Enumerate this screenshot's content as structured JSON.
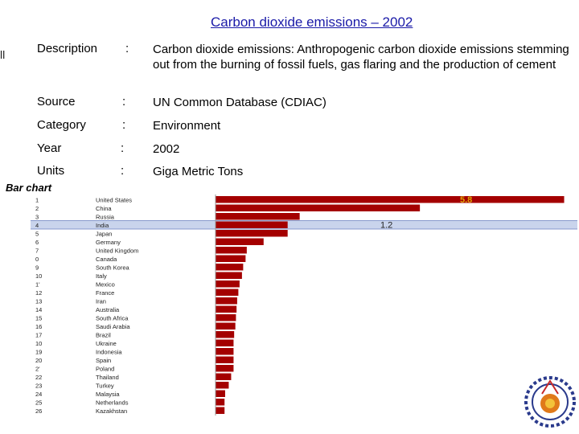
{
  "slide": {
    "title": "Carbon dioxide emissions – 2002",
    "edge_mark": "ll",
    "chart_heading": "Bar chart"
  },
  "meta": [
    {
      "key": "Description",
      "colon": ":",
      "value": "Carbon dioxide emissions: Anthropogenic carbon dioxide emissions stemming out from the burning of fossil fuels, gas flaring and the production of cement"
    },
    {
      "key": "Source",
      "colon": ":",
      "value": "UN Common Database (CDIAC)"
    },
    {
      "key": "Category",
      "colon": ":",
      "value": "Environment"
    },
    {
      "key": "Year",
      "colon": ":",
      "value": "2002"
    },
    {
      "key": "Units",
      "colon": ":",
      "value": "Giga Metric Tons"
    }
  ],
  "chart_data": {
    "type": "bar",
    "orientation": "horizontal",
    "ranks": [
      "1",
      "2",
      "3",
      "4",
      "5",
      "6",
      "7",
      "0",
      "9",
      "10",
      "1'",
      "12",
      "13",
      "14",
      "15",
      "16",
      "17",
      "10",
      "19",
      "20",
      "2'",
      "22",
      "23",
      "24",
      "25",
      "26"
    ],
    "categories": [
      "United States",
      "China",
      "Russia",
      "India",
      "Japan",
      "Germany",
      "United Kingdom",
      "Canada",
      "South Korea",
      "Italy",
      "Mexico",
      "France",
      "Iran",
      "Australia",
      "South Africa",
      "Saudi Arabia",
      "Brazil",
      "Ukraine",
      "Indonesia",
      "Spain",
      "Poland",
      "Thailand",
      "Turkey",
      "Malaysia",
      "Netherlands",
      "Kazakhstan"
    ],
    "values": [
      5.8,
      3.4,
      1.4,
      1.2,
      1.2,
      0.8,
      0.52,
      0.5,
      0.46,
      0.44,
      0.4,
      0.38,
      0.36,
      0.35,
      0.34,
      0.33,
      0.31,
      0.3,
      0.3,
      0.3,
      0.3,
      0.26,
      0.22,
      0.16,
      0.15,
      0.15
    ],
    "data_labels": [
      {
        "index": 0,
        "text": "5.8"
      },
      {
        "index": 3,
        "text": "1.2"
      }
    ],
    "highlight_index": 3,
    "xlim": [
      0,
      5.9
    ],
    "colors": {
      "bar": "#a40000",
      "highlight_row": "#c9d4ec",
      "label_top": "#e0a800",
      "grid": "#999999"
    }
  }
}
